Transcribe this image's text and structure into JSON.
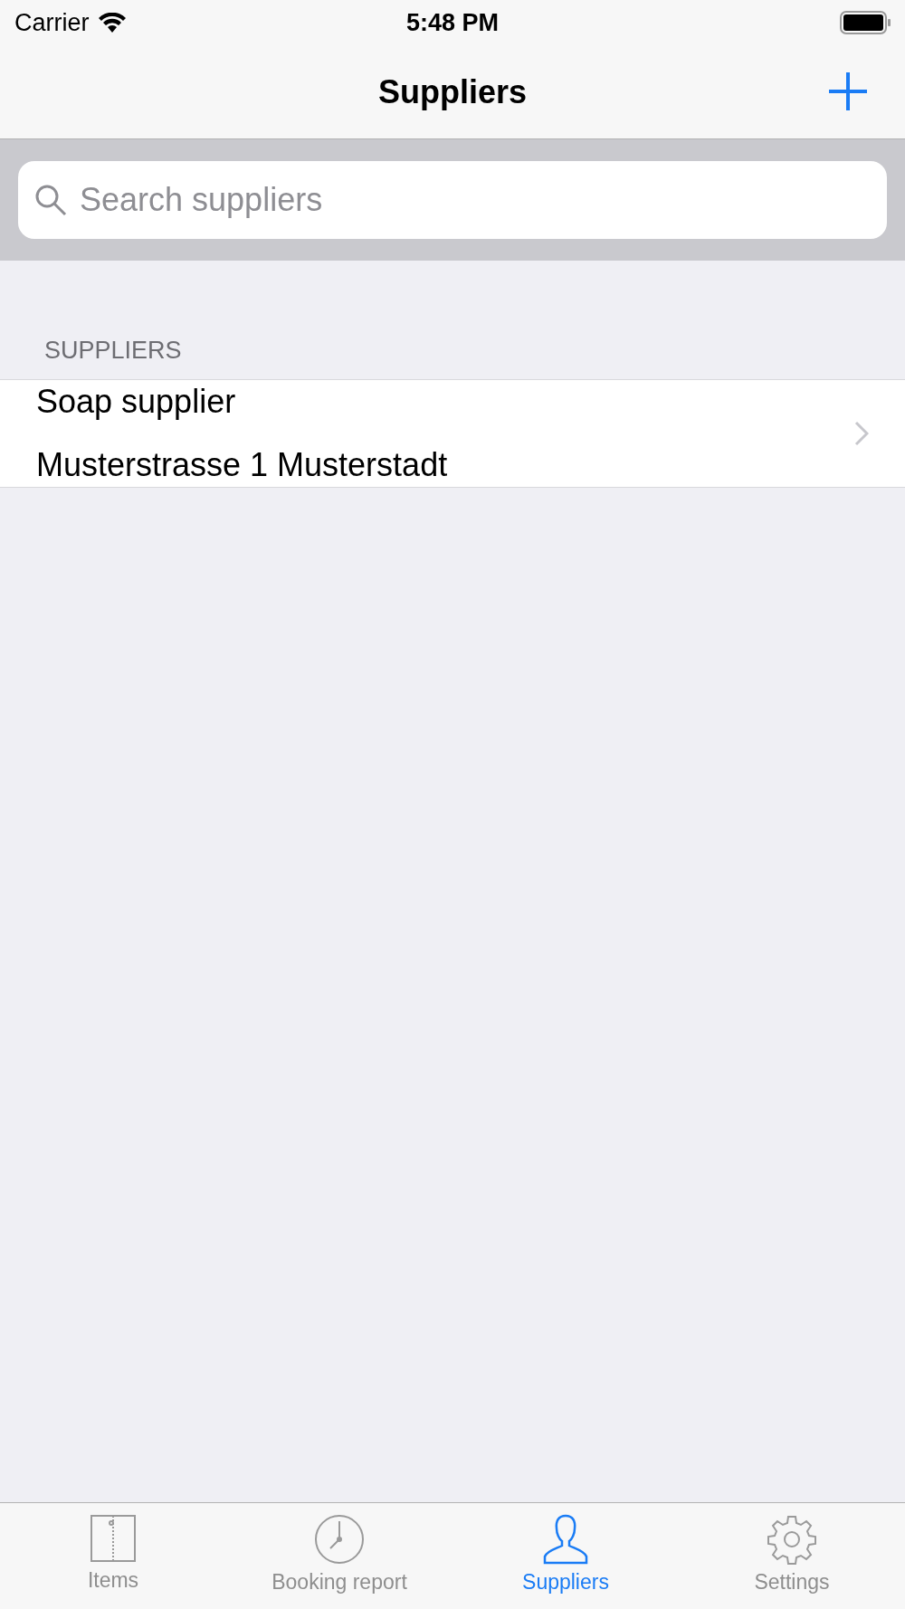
{
  "status_bar": {
    "carrier": "Carrier",
    "time": "5:48 PM"
  },
  "nav_bar": {
    "title": "Suppliers"
  },
  "search": {
    "placeholder": "Search suppliers"
  },
  "section": {
    "header": "SUPPLIERS"
  },
  "rows": [
    {
      "name": "Soap supplier",
      "address": "Musterstrasse 1 Musterstadt"
    }
  ],
  "tab_bar": [
    {
      "kind": "items",
      "label": "Items",
      "selected": false
    },
    {
      "kind": "clock",
      "label": "Booking report",
      "selected": false
    },
    {
      "kind": "person",
      "label": "Suppliers",
      "selected": true
    },
    {
      "kind": "gear",
      "label": "Settings",
      "selected": false
    }
  ]
}
